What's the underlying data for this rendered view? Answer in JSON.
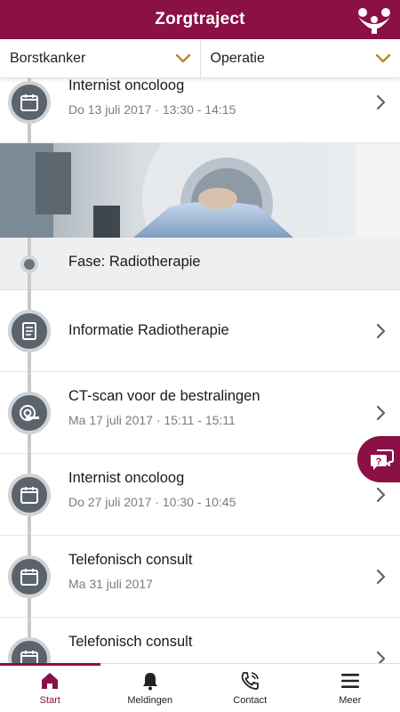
{
  "header": {
    "title": "Zorgtraject",
    "logo_icon": "people-logo-icon"
  },
  "filters": {
    "condition": "Borstkanker",
    "phase": "Operatie"
  },
  "timeline": {
    "items": [
      {
        "title": "Internist oncoloog",
        "subtitle": "Do 13 juli 2017 · 13:30 - 14:15",
        "icon": "calendar-icon"
      },
      {
        "title": "Informatie Radiotherapie",
        "subtitle": "",
        "icon": "document-icon"
      },
      {
        "title": "CT-scan voor de bestralingen",
        "subtitle": "Ma 17 juli 2017 · 15:11 - 15:11",
        "icon": "scanner-icon"
      },
      {
        "title": "Internist oncoloog",
        "subtitle": "Do 27 juli 2017 · 10:30 - 10:45",
        "icon": "calendar-icon"
      },
      {
        "title": "Telefonisch consult",
        "subtitle": "Ma 31 juli 2017",
        "icon": "calendar-icon"
      },
      {
        "title": "Telefonisch consult",
        "subtitle": "",
        "icon": "calendar-icon"
      }
    ],
    "phase": {
      "title": "Fase: Radiotherapie"
    }
  },
  "chat": {
    "icon": "chat-question-icon"
  },
  "tabs": [
    {
      "label": "Start",
      "icon": "home-icon",
      "active": true
    },
    {
      "label": "Meldingen",
      "icon": "bell-icon",
      "active": false
    },
    {
      "label": "Contact",
      "icon": "phone-icon",
      "active": false
    },
    {
      "label": "Meer",
      "icon": "menu-icon",
      "active": false
    }
  ],
  "colors": {
    "brand": "#8a1045",
    "node": "#5b636c",
    "chevron": "#b08a2c"
  }
}
